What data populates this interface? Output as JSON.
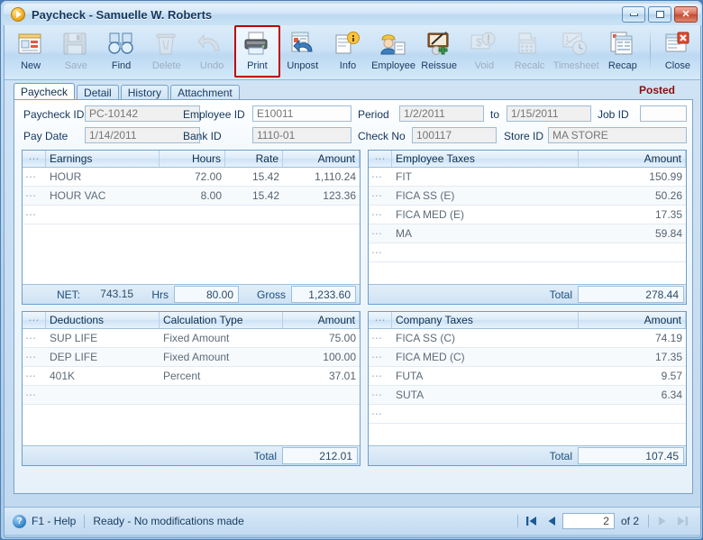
{
  "window": {
    "title": "Paycheck - Samuelle W. Roberts",
    "app_icon": "play-circle-icon",
    "minimize_label": "",
    "maximize_label": "",
    "close_label": "✕"
  },
  "toolbar": {
    "buttons": [
      {
        "label": "New",
        "icon": "new-document-icon",
        "enabled": true,
        "selected": false
      },
      {
        "label": "Save",
        "icon": "floppy-disk-icon",
        "enabled": false,
        "selected": false
      },
      {
        "label": "Find",
        "icon": "binoculars-icon",
        "enabled": true,
        "selected": false
      },
      {
        "label": "Delete",
        "icon": "trash-can-icon",
        "enabled": false,
        "selected": false
      },
      {
        "label": "Undo",
        "icon": "undo-arrow-icon",
        "enabled": false,
        "selected": false
      },
      {
        "label": "Print",
        "icon": "printer-icon",
        "enabled": true,
        "selected": true
      },
      {
        "label": "Unpost",
        "icon": "unpost-icon",
        "enabled": true,
        "selected": false
      },
      {
        "label": "Info",
        "icon": "info-document-icon",
        "enabled": true,
        "selected": false
      },
      {
        "label": "Employee",
        "icon": "employee-icon",
        "enabled": true,
        "selected": false
      },
      {
        "label": "Reissue",
        "icon": "reissue-icon",
        "enabled": true,
        "selected": false
      },
      {
        "label": "Void",
        "icon": "void-icon",
        "enabled": false,
        "selected": false
      },
      {
        "label": "Recalc",
        "icon": "calculator-icon",
        "enabled": false,
        "selected": false
      },
      {
        "label": "Timesheet",
        "icon": "timesheet-icon",
        "enabled": false,
        "selected": false
      },
      {
        "label": "Recap",
        "icon": "recap-icon",
        "enabled": true,
        "selected": false
      },
      {
        "label": "Close",
        "icon": "close-window-icon",
        "enabled": true,
        "selected": false
      }
    ]
  },
  "tabs": [
    {
      "label": "Paycheck",
      "active": true
    },
    {
      "label": "Detail",
      "active": false
    },
    {
      "label": "History",
      "active": false
    },
    {
      "label": "Attachment",
      "active": false
    }
  ],
  "status_badge": "Posted",
  "header_fields": [
    {
      "label": "Paycheck ID",
      "value": "PC-10142",
      "name": "paycheck-id"
    },
    {
      "label": "Employee ID",
      "value": "E10011",
      "name": "employee-id"
    },
    {
      "label": "Period",
      "value": "1/2/2011",
      "name": "period-from"
    },
    {
      "label": "to",
      "value": "1/15/2011",
      "name": "period-to"
    },
    {
      "label": "Job ID",
      "value": "",
      "name": "job-id"
    },
    {
      "label": "Pay Date",
      "value": "1/14/2011",
      "name": "pay-date"
    },
    {
      "label": "Bank ID",
      "value": "1110-01",
      "name": "bank-id"
    },
    {
      "label": "Check No",
      "value": "100117",
      "name": "check-no"
    },
    {
      "label": "Store ID",
      "value": "MA STORE",
      "name": "store-id"
    }
  ],
  "earnings_grid": {
    "title": "Earnings",
    "columns": [
      "",
      "Earnings",
      "Hours",
      "Rate",
      "Amount"
    ],
    "rows": [
      {
        "code": "HOUR",
        "hours": "72.00",
        "rate": "15.42",
        "amount": "1,110.24"
      },
      {
        "code": "HOUR VAC",
        "hours": "8.00",
        "rate": "15.42",
        "amount": "123.36"
      },
      {
        "code": "",
        "hours": "",
        "rate": "",
        "amount": ""
      }
    ],
    "footer": {
      "net_label": "NET:",
      "net_value": "743.15",
      "hrs_label": "Hrs",
      "hrs_value": "80.00",
      "gross_label": "Gross",
      "gross_value": "1,233.60"
    }
  },
  "employee_taxes_grid": {
    "title": "Employee Taxes",
    "columns": [
      "",
      "Employee Taxes",
      "Amount"
    ],
    "rows": [
      {
        "code": "FIT",
        "amount": "150.99"
      },
      {
        "code": "FICA SS (E)",
        "amount": "50.26"
      },
      {
        "code": "FICA MED (E)",
        "amount": "17.35"
      },
      {
        "code": "MA",
        "amount": "59.84"
      },
      {
        "code": "",
        "amount": ""
      }
    ],
    "footer": {
      "total_label": "Total",
      "total_value": "278.44"
    }
  },
  "deductions_grid": {
    "title": "Deductions",
    "columns": [
      "",
      "Deductions",
      "Calculation Type",
      "Amount"
    ],
    "rows": [
      {
        "code": "SUP LIFE",
        "calc": "Fixed Amount",
        "amount": "75.00"
      },
      {
        "code": "DEP LIFE",
        "calc": "Fixed Amount",
        "amount": "100.00"
      },
      {
        "code": "401K",
        "calc": "Percent",
        "amount": "37.01"
      },
      {
        "code": "",
        "calc": "",
        "amount": ""
      }
    ],
    "footer": {
      "total_label": "Total",
      "total_value": "212.01"
    }
  },
  "company_taxes_grid": {
    "title": "Company Taxes",
    "columns": [
      "",
      "Company Taxes",
      "Amount"
    ],
    "rows": [
      {
        "code": "FICA SS (C)",
        "amount": "74.19"
      },
      {
        "code": "FICA MED (C)",
        "amount": "17.35"
      },
      {
        "code": "FUTA",
        "amount": "9.57"
      },
      {
        "code": "SUTA",
        "amount": "6.34"
      },
      {
        "code": "",
        "amount": ""
      }
    ],
    "footer": {
      "total_label": "Total",
      "total_value": "107.45"
    }
  },
  "statusbar": {
    "help_icon": "question-mark-icon",
    "help_label": "F1 - Help",
    "ready_text": "Ready - No modifications made",
    "nav": {
      "first_icon": "first-record-icon",
      "prev_icon": "previous-record-icon",
      "page_value": "2",
      "of_label": "of  2",
      "next_icon": "next-record-icon",
      "last_icon": "last-record-icon"
    }
  },
  "colors": {
    "accent": "#2f7fc4",
    "posted": "#8b0f0f",
    "selection_highlight": "#c00000",
    "frame": "#4b7fb5"
  }
}
